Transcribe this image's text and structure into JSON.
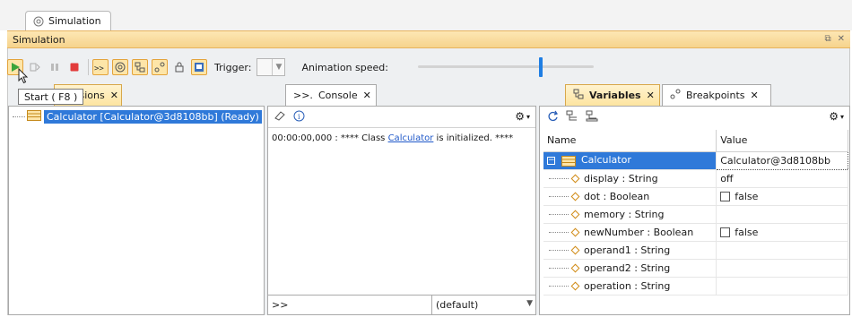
{
  "outer_tab": {
    "label": "Simulation"
  },
  "window": {
    "title": "Simulation"
  },
  "toolbar": {
    "trigger_label": "Trigger:",
    "trigger_value": "",
    "animation_label": "Animation speed:",
    "animation_speed": 0.7
  },
  "tooltip": {
    "text": "Start ( F8 )"
  },
  "sessions": {
    "tab_label": "Sessions",
    "item_label": "Calculator [Calculator@3d8108bb] (Ready)"
  },
  "console": {
    "tab_label": "Console",
    "message_prefix": "00:00:00,000 : **** Class ",
    "message_link": "Calculator",
    "message_suffix": " is initialized. ****",
    "input_prompt": ">>",
    "context_value": "(default)"
  },
  "variables": {
    "tab_label": "Variables",
    "breakpoints_tab_label": "Breakpoints",
    "columns": [
      "Name",
      "Value"
    ],
    "root": {
      "name": "Calculator",
      "value": "Calculator@3d8108bb"
    },
    "rows": [
      {
        "name": "display : String",
        "value": "off",
        "checkbox": false
      },
      {
        "name": "dot : Boolean",
        "value": "false",
        "checkbox": true
      },
      {
        "name": "memory : String",
        "value": "",
        "checkbox": false
      },
      {
        "name": "newNumber : Boolean",
        "value": "false",
        "checkbox": true
      },
      {
        "name": "operand1 : String",
        "value": "",
        "checkbox": false
      },
      {
        "name": "operand2 : String",
        "value": "",
        "checkbox": false
      },
      {
        "name": "operation : String",
        "value": "",
        "checkbox": false
      }
    ]
  },
  "colors": {
    "accent_orange": "#f6d38c",
    "selection_blue": "#2f79d9",
    "link_blue": "#1f58c9",
    "slider_blue": "#1f7ee3"
  }
}
